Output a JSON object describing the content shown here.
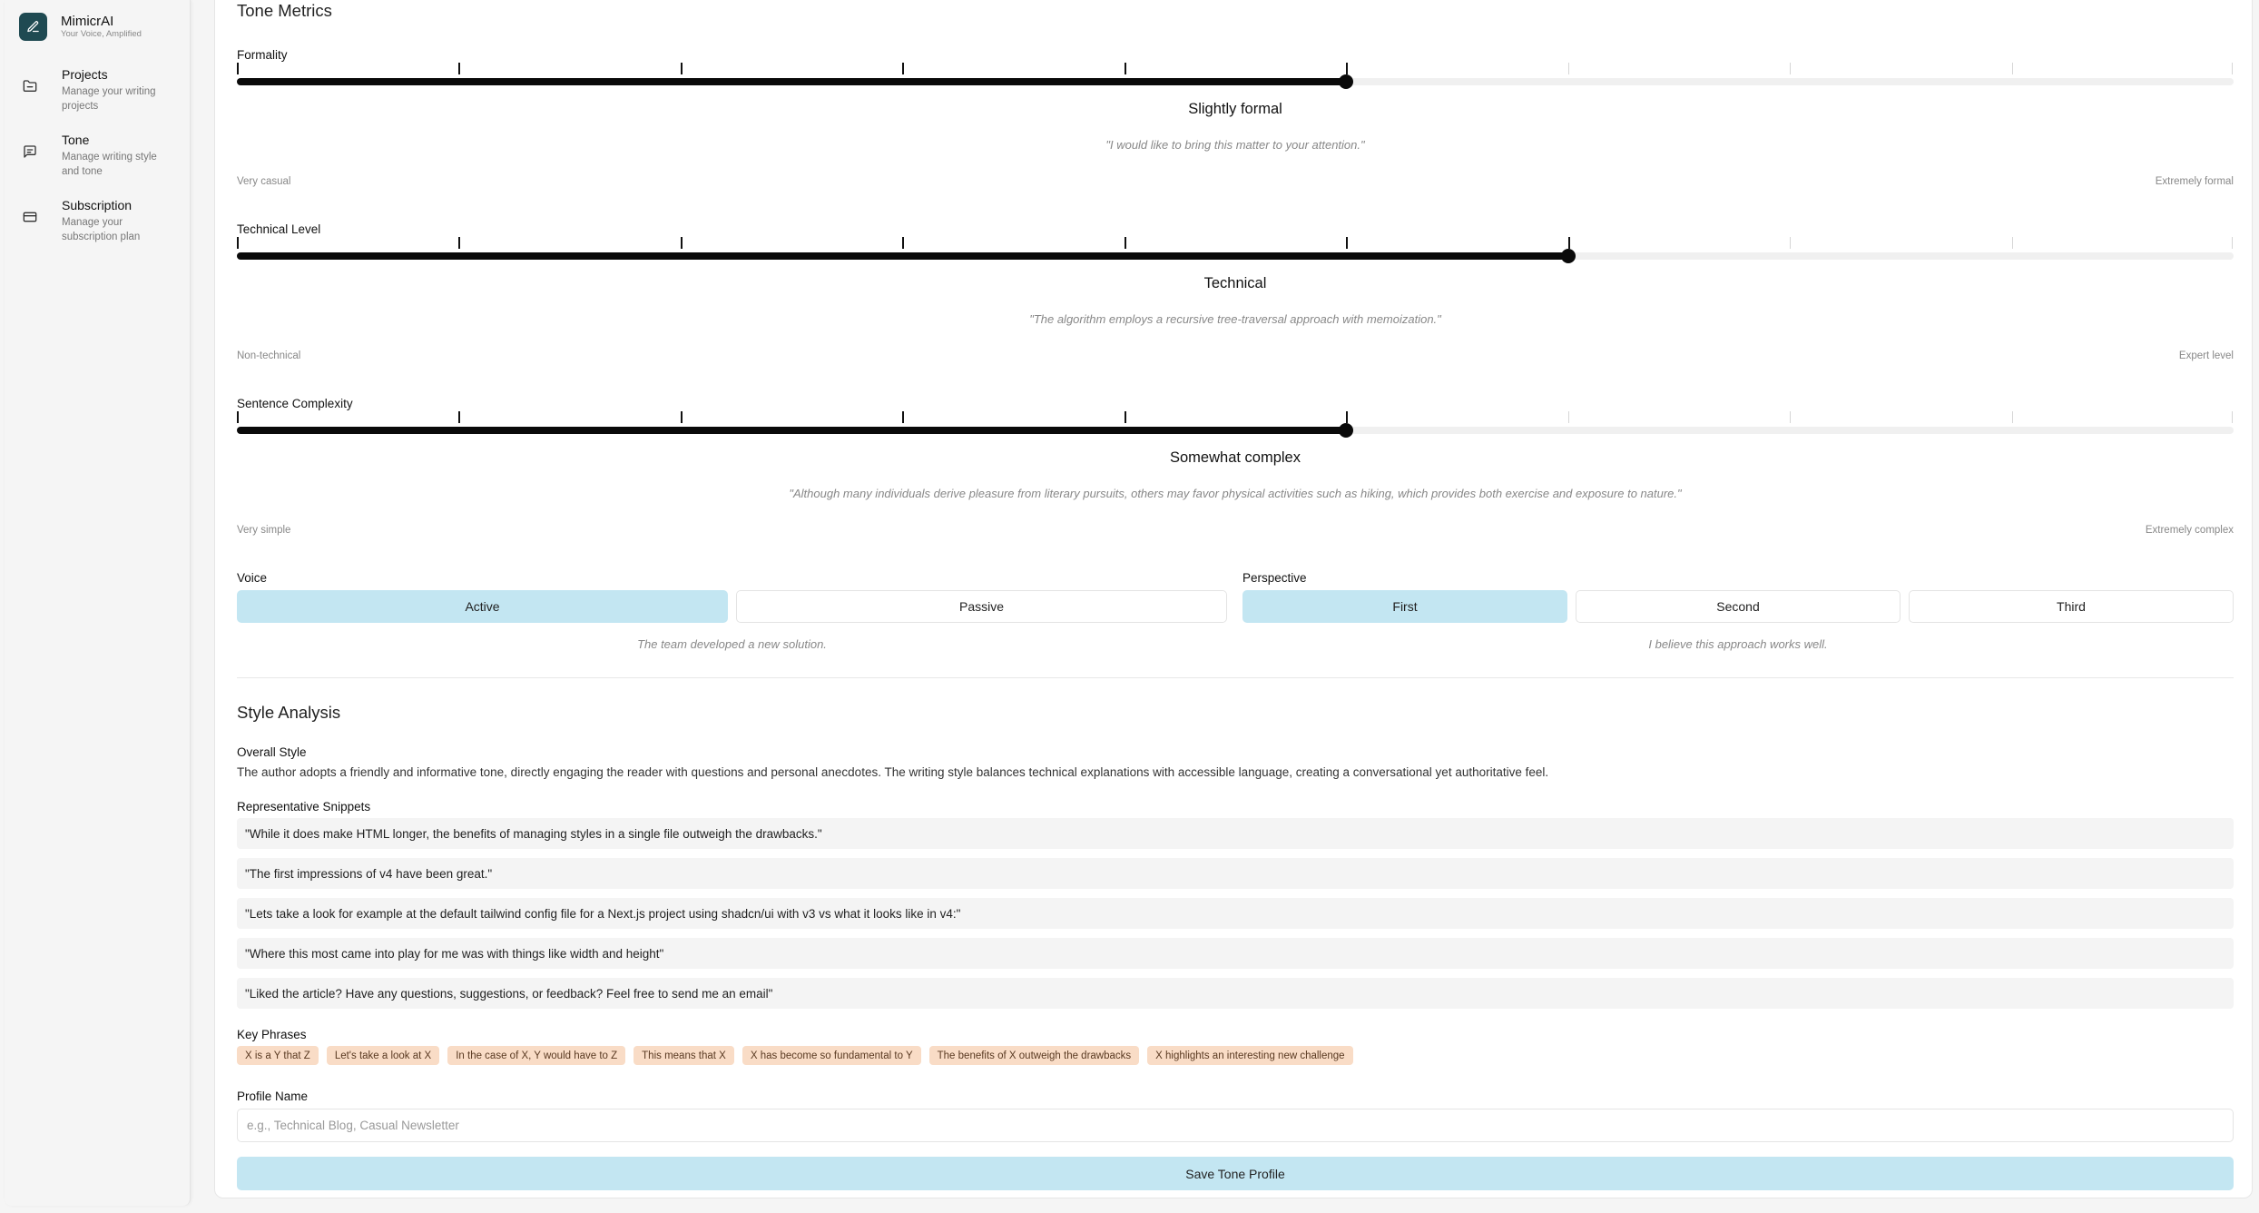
{
  "app": {
    "name": "MimicrAI",
    "tagline": "Your Voice, Amplified"
  },
  "sidebar": {
    "items": [
      {
        "title": "Projects",
        "description": "Manage your writing projects",
        "icon": "folder-icon"
      },
      {
        "title": "Tone",
        "description": "Manage writing style and tone",
        "icon": "message-icon"
      },
      {
        "title": "Subscription",
        "description": "Manage your subscription plan",
        "icon": "credit-card-icon"
      }
    ]
  },
  "tone_metrics": {
    "title": "Tone Metrics",
    "metrics": [
      {
        "label": "Formality",
        "level": 6,
        "max_level": 10,
        "value_label": "Slightly formal",
        "example": "\"I would like to bring this matter to your attention.\"",
        "min_label": "Very casual",
        "max_label": "Extremely formal"
      },
      {
        "label": "Technical Level",
        "level": 7,
        "max_level": 10,
        "value_label": "Technical",
        "example": "\"The algorithm employs a recursive tree-traversal approach with memoization.\"",
        "min_label": "Non-technical",
        "max_label": "Expert level"
      },
      {
        "label": "Sentence Complexity",
        "level": 6,
        "max_level": 10,
        "value_label": "Somewhat complex",
        "example": "\"Although many individuals derive pleasure from literary pursuits, others may favor physical activities such as hiking, which provides both exercise and exposure to nature.\"",
        "min_label": "Very simple",
        "max_label": "Extremely complex"
      }
    ],
    "voice": {
      "label": "Voice",
      "options": [
        "Active",
        "Passive"
      ],
      "selected": "Active",
      "example": "The team developed a new solution."
    },
    "perspective": {
      "label": "Perspective",
      "options": [
        "First",
        "Second",
        "Third"
      ],
      "selected": "First",
      "example": "I believe this approach works well."
    }
  },
  "style_analysis": {
    "title": "Style Analysis",
    "overall_label": "Overall Style",
    "overall_text": "The author adopts a friendly and informative tone, directly engaging the reader with questions and personal anecdotes. The writing style balances technical explanations with accessible language, creating a conversational yet authoritative feel.",
    "snippets_label": "Representative Snippets",
    "snippets": [
      "\"While it does make HTML longer, the benefits of managing styles in a single file outweigh the drawbacks.\"",
      "\"The first impressions of v4 have been great.\"",
      "\"Lets take a look for example at the default tailwind config file for a Next.js project using shadcn/ui with v3 vs what it looks like in v4:\"",
      "\"Where this most came into play for me was with things like width and height\"",
      "\"Liked the article? Have any questions, suggestions, or feedback? Feel free to send me an email\""
    ],
    "key_phrases_label": "Key Phrases",
    "key_phrases": [
      "X is a Y that Z",
      "Let's take a look at X",
      "In the case of X, Y would have to Z",
      "This means that X",
      "X has become so fundamental to Y",
      "The benefits of X outweigh the drawbacks",
      "X highlights an interesting new challenge"
    ]
  },
  "profile": {
    "name_label": "Profile Name",
    "name_value": "",
    "name_placeholder": "e.g., Technical Blog, Casual Newsletter",
    "save_label": "Save Tone Profile"
  },
  "colors": {
    "accent": "#c3e6f2",
    "brand": "#1f4a52",
    "phrase_bg": "#f9dcc6"
  }
}
